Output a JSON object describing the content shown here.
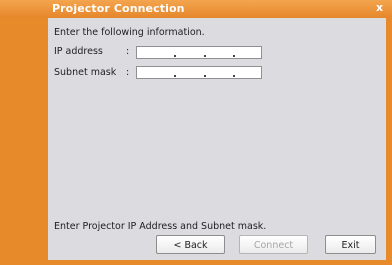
{
  "window": {
    "title": "Projector Connection",
    "close_glyph": "x"
  },
  "form": {
    "instruction": "Enter the following information.",
    "ip_label": "IP address",
    "ip_colon": ":",
    "subnet_label": "Subnet mask",
    "subnet_colon": ":",
    "ip_value": "",
    "subnet_value": ""
  },
  "status": {
    "message": "Enter Projector IP Address and Subnet mask."
  },
  "buttons": {
    "back": "< Back",
    "connect": "Connect",
    "exit": "Exit"
  },
  "colors": {
    "accent": "#e78a2a",
    "client_bg": "#dcdbe0"
  },
  "icons": {
    "close": "close-icon"
  }
}
